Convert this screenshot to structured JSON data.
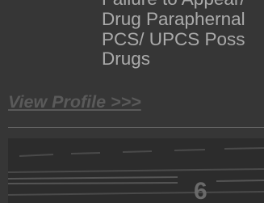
{
  "record": {
    "charges": [
      "Failure to Appear/",
      "Drug Paraphernal",
      "PCS/ UPCS Poss",
      "Drugs"
    ],
    "view_profile_label": "View Profile >>>"
  },
  "photo": {
    "height_marker": "6"
  },
  "colors": {
    "background": "#363636",
    "text": "#aaaaaa",
    "link": "#5a5a5a",
    "photo_background": "#2c2c2c"
  }
}
